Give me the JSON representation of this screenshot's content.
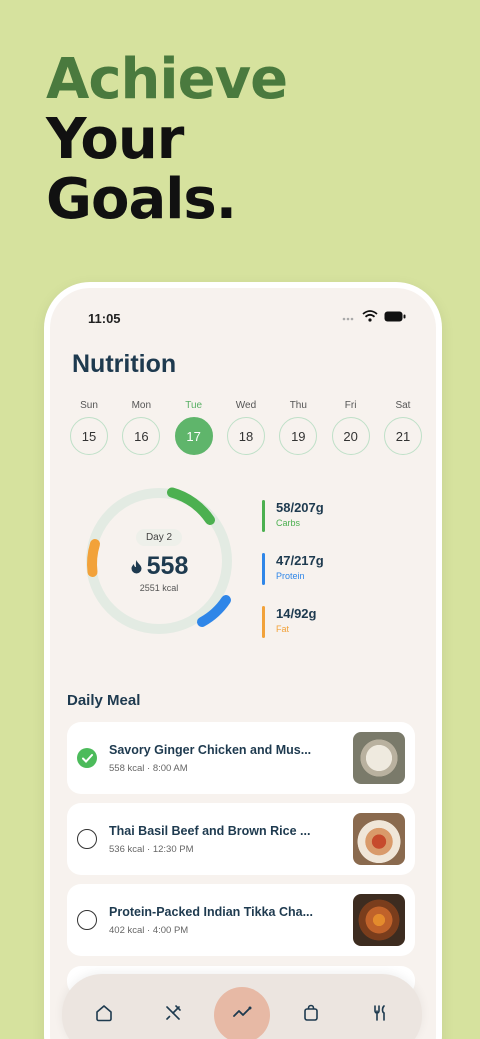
{
  "headline": {
    "line1": "Achieve",
    "line2": "Your",
    "line3": "Goals."
  },
  "status": {
    "time": "11:05",
    "icons": [
      "wifi-icon",
      "battery-icon"
    ]
  },
  "app": {
    "title": "Nutrition"
  },
  "week": [
    {
      "day": "Sun",
      "date": "15",
      "selected": false
    },
    {
      "day": "Mon",
      "date": "16",
      "selected": false
    },
    {
      "day": "Tue",
      "date": "17",
      "selected": true
    },
    {
      "day": "Wed",
      "date": "18",
      "selected": false
    },
    {
      "day": "Thu",
      "date": "19",
      "selected": false
    },
    {
      "day": "Fri",
      "date": "20",
      "selected": false
    },
    {
      "day": "Sat",
      "date": "21",
      "selected": false
    }
  ],
  "summary": {
    "day_label": "Day 2",
    "kcal_value": "558",
    "kcal_goal": "2551 kcal",
    "flame_icon": "flame-icon"
  },
  "macros": [
    {
      "value": "58/207g",
      "label": "Carbs",
      "color": "#4cb050"
    },
    {
      "value": "47/217g",
      "label": "Protein",
      "color": "#2f86e8"
    },
    {
      "value": "14/92g",
      "label": "Fat",
      "color": "#f2a23a"
    }
  ],
  "daily_meal": {
    "title": "Daily Meal",
    "items": [
      {
        "name": "Savory Ginger Chicken and Mus...",
        "meta": "558 kcal · 8:00 AM",
        "done": true
      },
      {
        "name": "Thai Basil Beef and Brown Rice ...",
        "meta": "536 kcal · 12:30 PM",
        "done": false
      },
      {
        "name": "Protein-Packed Indian Tikka Cha...",
        "meta": "402 kcal · 4:00 PM",
        "done": false
      }
    ]
  },
  "nav": [
    "home-icon",
    "utensils-cross-icon",
    "activity-icon",
    "bag-icon",
    "fork-knife-icon"
  ],
  "colors": {
    "background": "#d6e29e",
    "accent_green": "#4a7a3e",
    "selected_day": "#5fb56b",
    "nav_active": "#e7b9a5"
  }
}
